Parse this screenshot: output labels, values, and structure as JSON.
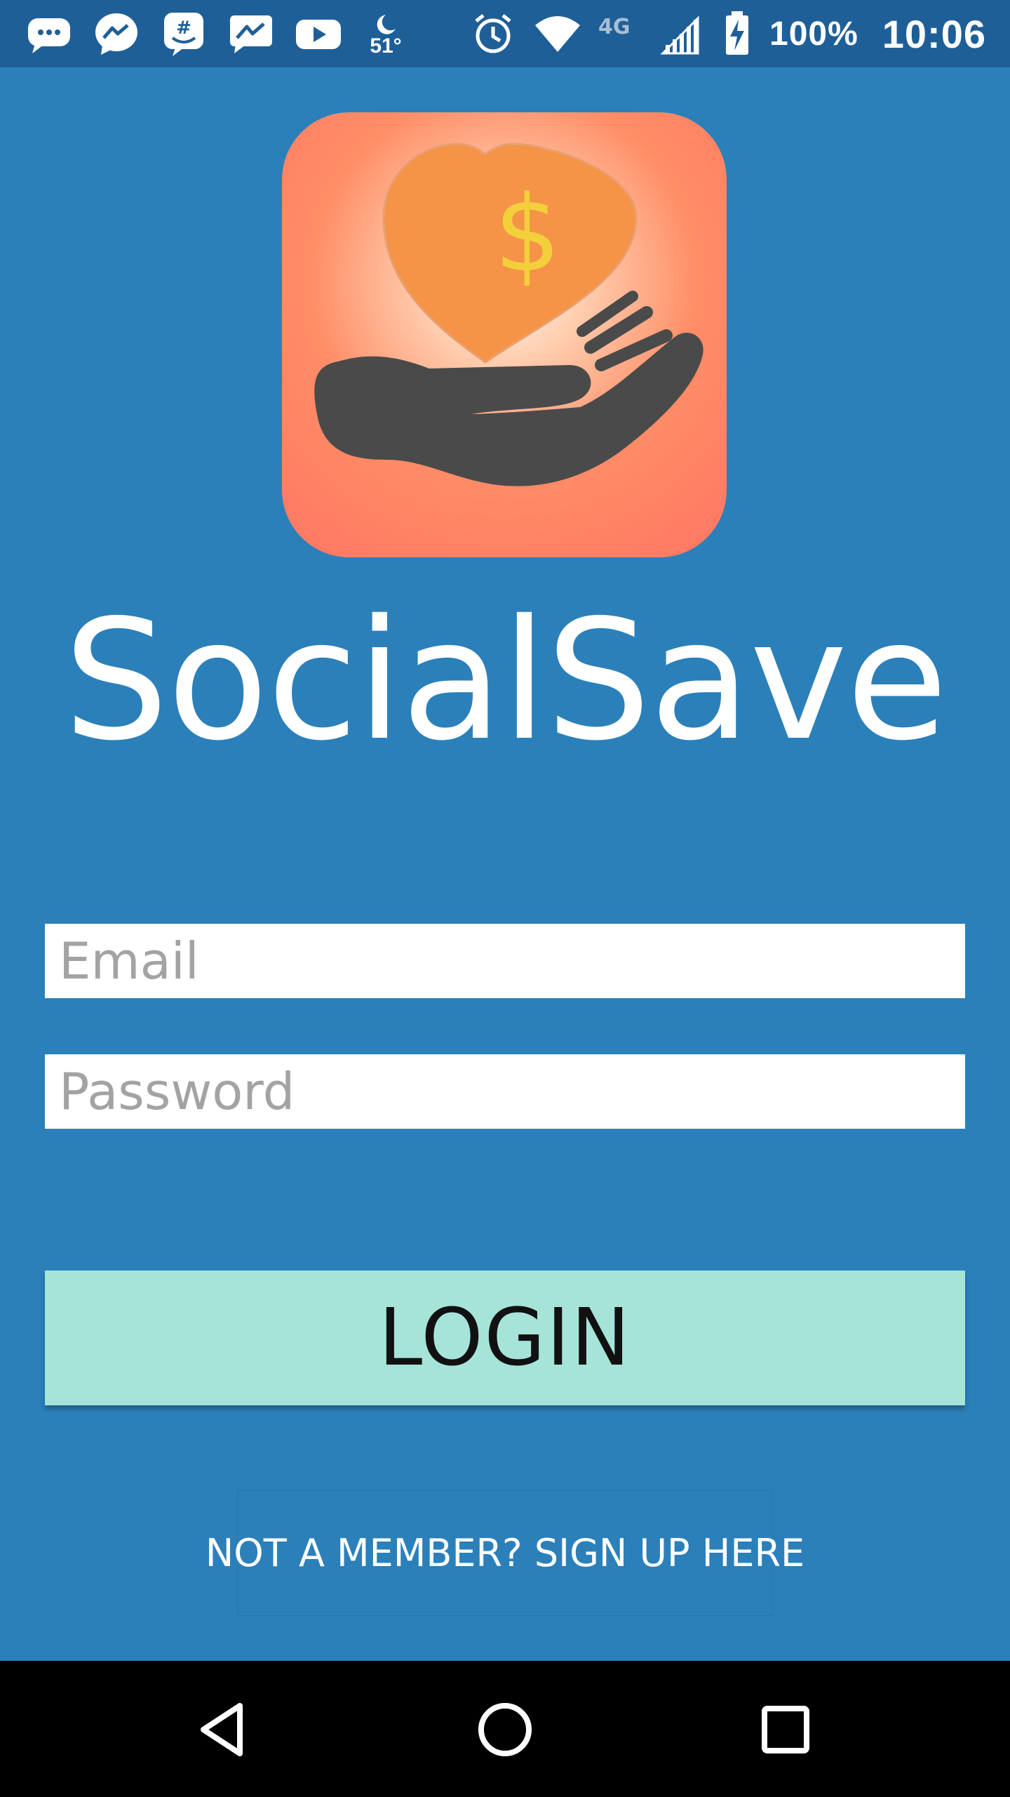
{
  "status_bar": {
    "icons_left": [
      "chat-bubble-icon",
      "messenger-icon",
      "groupme-icon",
      "messenger-alt-icon",
      "youtube-icon",
      "weather-moon-icon"
    ],
    "weather_temp": "51°",
    "icons_right": [
      "alarm-icon",
      "wifi-icon",
      "lte-icon",
      "signal-icon",
      "battery-charging-icon"
    ],
    "network_label": "4G",
    "battery": "100%",
    "time": "10:06"
  },
  "app": {
    "title": "SocialSave",
    "logo_icon": "heart-dollar-hand-icon",
    "accent_color": "#2b80ba"
  },
  "form": {
    "email_placeholder": "Email",
    "password_placeholder": "Password",
    "login_label": "LOGIN",
    "signup_label": "NOT A MEMBER? SIGN UP HERE"
  },
  "nav": {
    "icons": [
      "back-icon",
      "home-icon",
      "recent-apps-icon"
    ]
  }
}
